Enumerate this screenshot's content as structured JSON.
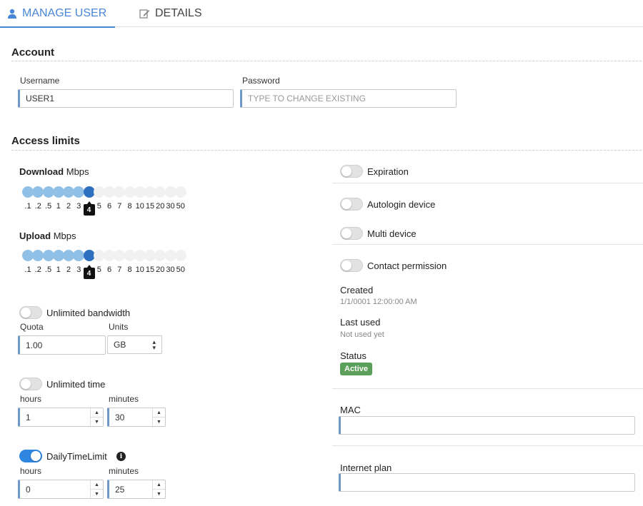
{
  "tabs": {
    "manage_user": "MANAGE USER",
    "details": "DETAILS"
  },
  "account": {
    "title": "Account",
    "username_label": "Username",
    "username_value": "USER1",
    "password_label": "Password",
    "password_placeholder": "TYPE TO CHANGE EXISTING"
  },
  "access": {
    "title": "Access limits",
    "download": {
      "bold": "Download",
      "unit": "Mbps",
      "value_label": "4",
      "selected_index": 6
    },
    "upload": {
      "bold": "Upload",
      "unit": "Mbps",
      "value_label": "4",
      "selected_index": 6
    },
    "speed_ticks": [
      ".1",
      ".2",
      ".5",
      "1",
      "2",
      "3",
      "4",
      "5",
      "6",
      "7",
      "8",
      "10",
      "15",
      "20",
      "30",
      "50"
    ],
    "unlimited_bandwidth": {
      "label": "Unlimited bandwidth",
      "on": false
    },
    "quota_label": "Quota",
    "quota_value": "1.00",
    "units_label": "Units",
    "units_value": "GB",
    "unlimited_time": {
      "label": "Unlimited time",
      "on": false
    },
    "time": {
      "hours_label": "hours",
      "hours": "1",
      "minutes_label": "minutes",
      "minutes": "30"
    },
    "daily_limit": {
      "label": "DailyTimeLimit",
      "on": true,
      "info_glyph": "i"
    },
    "daily": {
      "hours_label": "hours",
      "hours": "0",
      "minutes_label": "minutes",
      "minutes": "25"
    }
  },
  "right": {
    "expiration": "Expiration",
    "autologin": "Autologin device",
    "multi_device": "Multi device",
    "contact_permission": "Contact permission",
    "created_label": "Created",
    "created_value": "1/1/0001 12:00:00 AM",
    "last_used_label": "Last used",
    "last_used_value": "Not used yet",
    "status_label": "Status",
    "status_value": "Active",
    "mac_label": "MAC",
    "mac_value": "",
    "plan_label": "Internet plan",
    "plan_value": ""
  },
  "colors": {
    "accent": "#4a86d8",
    "slider_filled": "#90c0e6",
    "slider_knob": "#2f6fbf",
    "toggle_on": "#2f86e0",
    "status_active": "#5aa05a"
  }
}
